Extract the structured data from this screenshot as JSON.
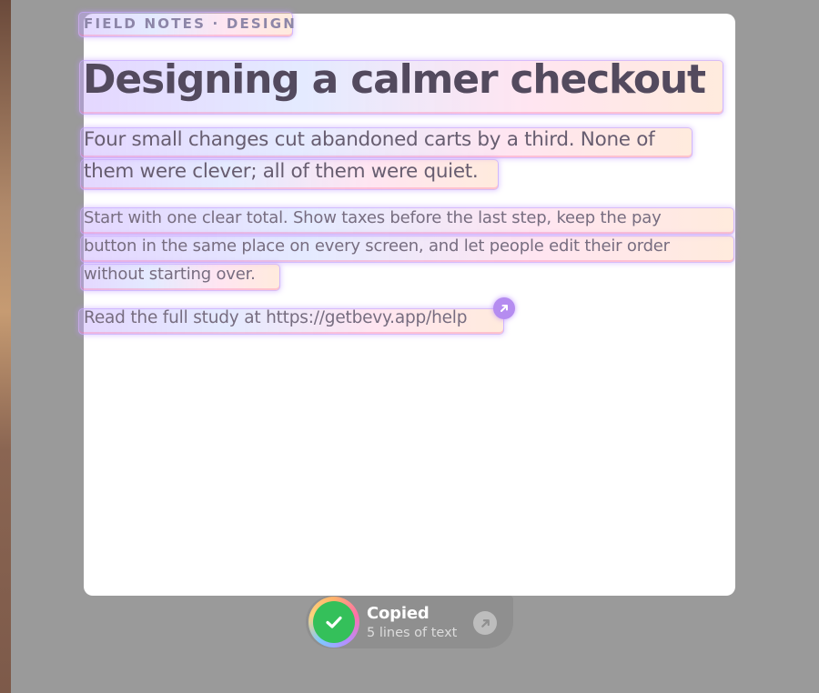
{
  "document": {
    "eyebrow": "FIELD NOTES · DESIGN",
    "title": "Designing a calmer checkout",
    "lede_lines": [
      "Four small changes cut abandoned carts by a third. None of",
      "them were clever; all of them were quiet."
    ],
    "body_lines": [
      "Start with one clear total. Show taxes before the last step, keep the pay",
      "button in the same place on every screen, and let people edit their order",
      "without starting over."
    ],
    "link_prefix": "Read the full study at ",
    "link_url": "https://getbevy.app/help"
  },
  "toast": {
    "title": "Copied",
    "subtitle": "5 lines of text"
  },
  "colors": {
    "success": "#34c05a",
    "highlight_accent": "#b58cf0",
    "background": "#9a9a9a"
  },
  "icons": {
    "copied": "checkmark-icon",
    "open": "arrow-up-right-icon"
  }
}
